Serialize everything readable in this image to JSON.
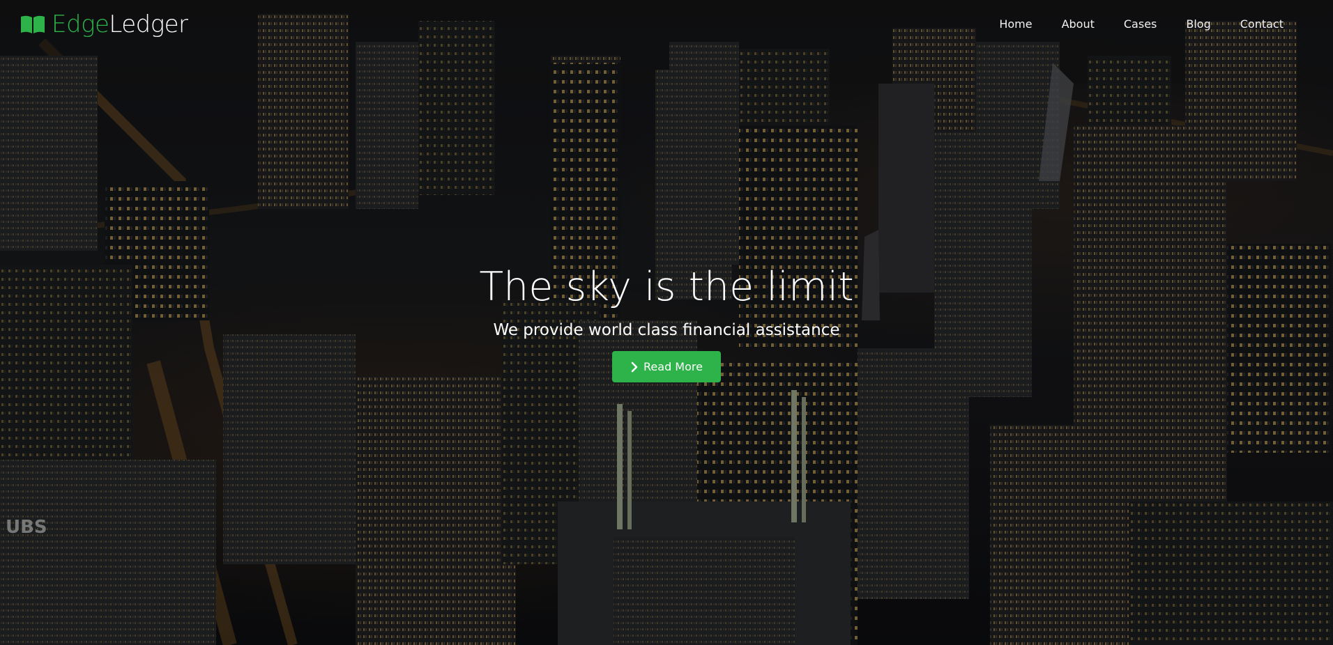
{
  "brand": {
    "name_part1": "Edge",
    "name_part2": "Ledger",
    "icon": "open-book-icon",
    "accent_color": "#2db34a"
  },
  "nav": {
    "items": [
      {
        "label": "Home"
      },
      {
        "label": "About"
      },
      {
        "label": "Cases"
      },
      {
        "label": "Blog"
      },
      {
        "label": "Contact"
      }
    ]
  },
  "hero": {
    "title": "The sky is the limit",
    "subtitle": "We provide world class financial assistance",
    "button_label": "Read More",
    "button_icon": "chevron-right-icon",
    "button_color": "#2db34a",
    "background": "night-city-aerial-image"
  },
  "background_text": {
    "building_sign": "UBS"
  }
}
